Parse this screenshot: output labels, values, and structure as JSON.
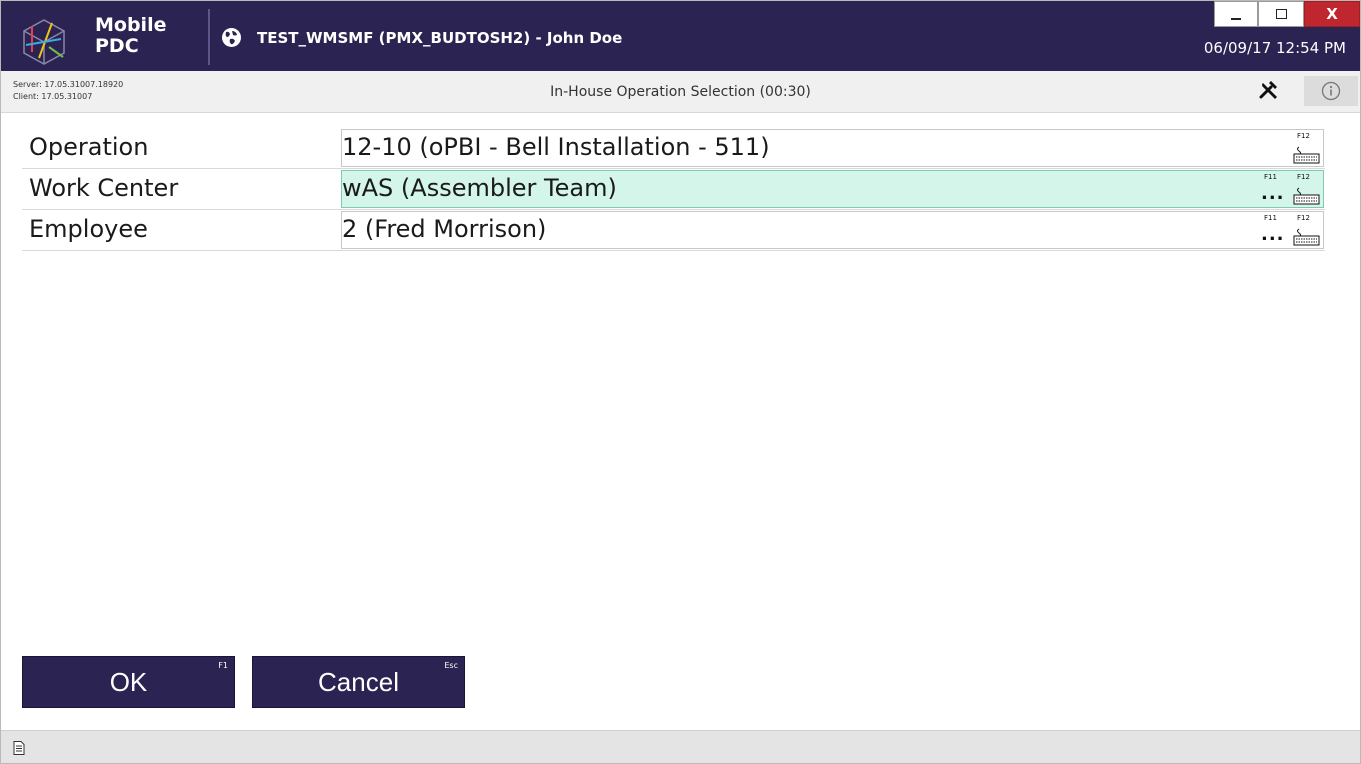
{
  "titlebar": {
    "brand_line1": "Mobile",
    "brand_line2": "PDC",
    "session_title": "TEST_WMSMF (PMX_BUDTOSH2) - John Doe",
    "datetime": "06/09/17 12:54 PM",
    "window_controls": {
      "minimize": "_",
      "maximize": "□",
      "close": "X"
    }
  },
  "subheader": {
    "server_version": "Server: 17.05.31007.18920",
    "client_version": "Client: 17.05.31007",
    "screen_title": "In-House Operation Selection (00:30)",
    "icons": [
      "tools-icon",
      "info-icon"
    ]
  },
  "form": {
    "rows": [
      {
        "label": "Operation",
        "value": "12-10 (oPBI - Bell Installation - 511)",
        "hotkeys": [
          "F12"
        ],
        "has_lookup": false,
        "active": false
      },
      {
        "label": "Work Center",
        "value": "wAS (Assembler Team)",
        "hotkeys": [
          "F11",
          "F12"
        ],
        "has_lookup": true,
        "active": true
      },
      {
        "label": "Employee",
        "value": "2 (Fred Morrison)",
        "hotkeys": [
          "F11",
          "F12"
        ],
        "has_lookup": true,
        "active": false
      }
    ],
    "lookup_dots": "...",
    "keyboard_icon": "keyboard-icon"
  },
  "buttons": {
    "ok_label": "OK",
    "ok_hotkey": "F1",
    "cancel_label": "Cancel",
    "cancel_hotkey": "Esc"
  },
  "statusbar": {
    "icons": [
      "log-icon"
    ]
  },
  "colors": {
    "header_bg": "#2b2452",
    "active_field_bg": "#d3f5ea",
    "close_button": "#c0262d",
    "button_bg": "#2b2452"
  }
}
